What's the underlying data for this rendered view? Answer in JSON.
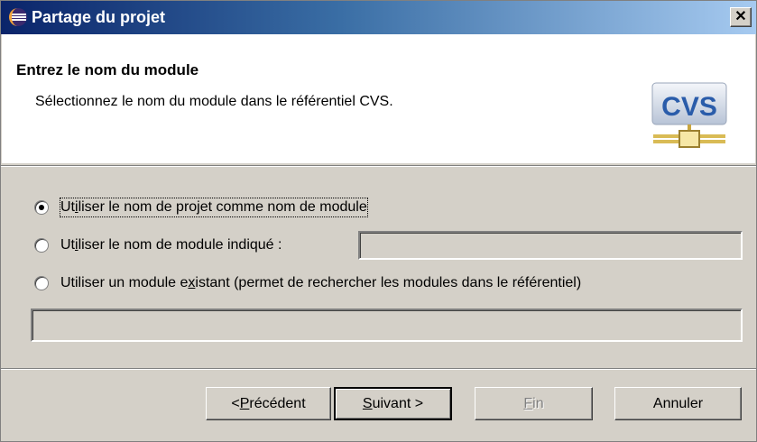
{
  "window": {
    "title": "Partage du projet",
    "close_glyph": "✕"
  },
  "banner": {
    "title": "Entrez le nom du module",
    "description": "Sélectionnez le nom du module dans le référentiel CVS.",
    "logo_text": "CVS",
    "logo_icon": "cvs-repository-icon"
  },
  "options": {
    "use_project_name": {
      "pre": "Ut",
      "mnemonic": "i",
      "post": "liser le nom de projet comme nom de module",
      "selected": true
    },
    "use_specified_name": {
      "pre": "Ut",
      "mnemonic": "i",
      "post": "liser le nom de module indiqué :",
      "selected": false,
      "value": ""
    },
    "use_existing_module": {
      "pre": "Utiliser un module e",
      "mnemonic": "x",
      "post": "istant (permet de rechercher les modules dans le référentiel)",
      "selected": false,
      "value": ""
    }
  },
  "buttons": {
    "back": {
      "pre": "< ",
      "mnemonic": "P",
      "post": "récédent"
    },
    "next": {
      "pre": "",
      "mnemonic": "S",
      "post": "uivant >"
    },
    "finish": {
      "pre": "",
      "mnemonic": "F",
      "post": "in"
    },
    "cancel": {
      "pre": "",
      "mnemonic": "",
      "post": "Annuler"
    }
  },
  "colors": {
    "titlebar_start": "#0a246a",
    "titlebar_end": "#a6caf0",
    "dialog_bg": "#d4d0c8",
    "cvs_blue": "#2a5caa"
  }
}
